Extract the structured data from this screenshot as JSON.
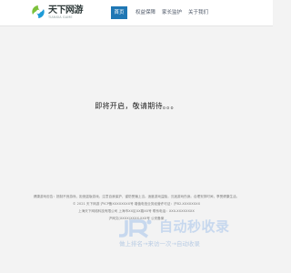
{
  "logo": {
    "title": "天下网游",
    "subtitle": "TIANXIA GAME",
    "icon": "swirl-logo-icon",
    "colors": {
      "green": "#7cc13b",
      "blue": "#1e9bd7"
    }
  },
  "nav": {
    "items": [
      {
        "label": "首页",
        "active": true
      },
      {
        "label": "权益保障",
        "active": false
      },
      {
        "label": "家长监护",
        "active": false
      },
      {
        "label": "关于我们",
        "active": false
      }
    ],
    "active_color": "#1f77b4"
  },
  "main": {
    "notice": "即将开启，敬请期待。。。"
  },
  "footer": {
    "lines": [
      "健康游戏忠告：抵制不良游戏，拒绝盗版游戏。注意自我保护，谨防受骗上当。适度游戏益脑，沉迷游戏伤身。合理安排时间，享受健康生活。",
      "© 2021 天下网游 沪ICP备XXXXXXXX号     增值电信业务经营许可证：沪B2-XXXXXXXX",
      "上海天下网络科技有限公司     上海市XX区XX路XX号     联系电话：XXX-XXXXXXXX",
      "沪网文(XXXX)XXXX-XXX号     公安备案"
    ]
  },
  "watermark": {
    "title": "自动秒收录",
    "slogan": "做上排名→来访一次→自动收录",
    "icon": "jr-logo-icon",
    "color": "#c7d8ee"
  }
}
